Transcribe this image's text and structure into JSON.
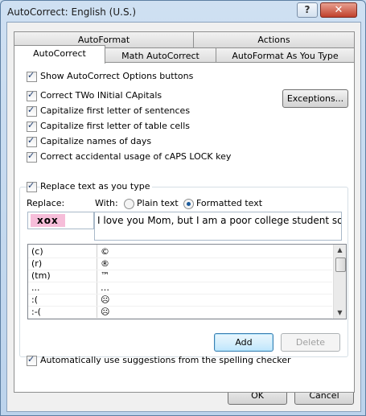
{
  "window": {
    "title": "AutoCorrect: English (U.S.)",
    "help_label": "?",
    "close_label": "✕"
  },
  "tabs": {
    "row1": [
      "AutoFormat",
      "Actions"
    ],
    "row2": [
      "AutoCorrect",
      "Math AutoCorrect",
      "AutoFormat As You Type"
    ]
  },
  "options": {
    "show_buttons": "Show AutoCorrect Options buttons",
    "two_initial": "Correct TWo INitial CApitals",
    "first_sentence": "Capitalize first letter of sentences",
    "first_table": "Capitalize first letter of table cells",
    "names_days": "Capitalize names of days",
    "caps_lock": "Correct accidental usage of cAPS LOCK key",
    "exceptions_label": "Exceptions..."
  },
  "replace": {
    "checkbox_label": "Replace text as you type",
    "replace_label": "Replace:",
    "with_label": "With:",
    "plain_text": "Plain text",
    "formatted_text": "Formatted text",
    "replace_value": "xox",
    "with_value": "I love you Mom, but I am a poor college student so",
    "entries": [
      [
        "(c)",
        "©"
      ],
      [
        "(r)",
        "®"
      ],
      [
        "(tm)",
        "™"
      ],
      [
        "...",
        "…"
      ],
      [
        ":(",
        "☹"
      ],
      [
        ":-(",
        "☹"
      ]
    ],
    "add_label": "Add",
    "delete_label": "Delete"
  },
  "spelling": {
    "label": "Automatically use suggestions from the spelling checker"
  },
  "footer": {
    "ok_label": "OK",
    "cancel_label": "Cancel"
  },
  "colors": {
    "replace_highlight": "#f6bdd9",
    "accent": "#1c5b9c"
  }
}
